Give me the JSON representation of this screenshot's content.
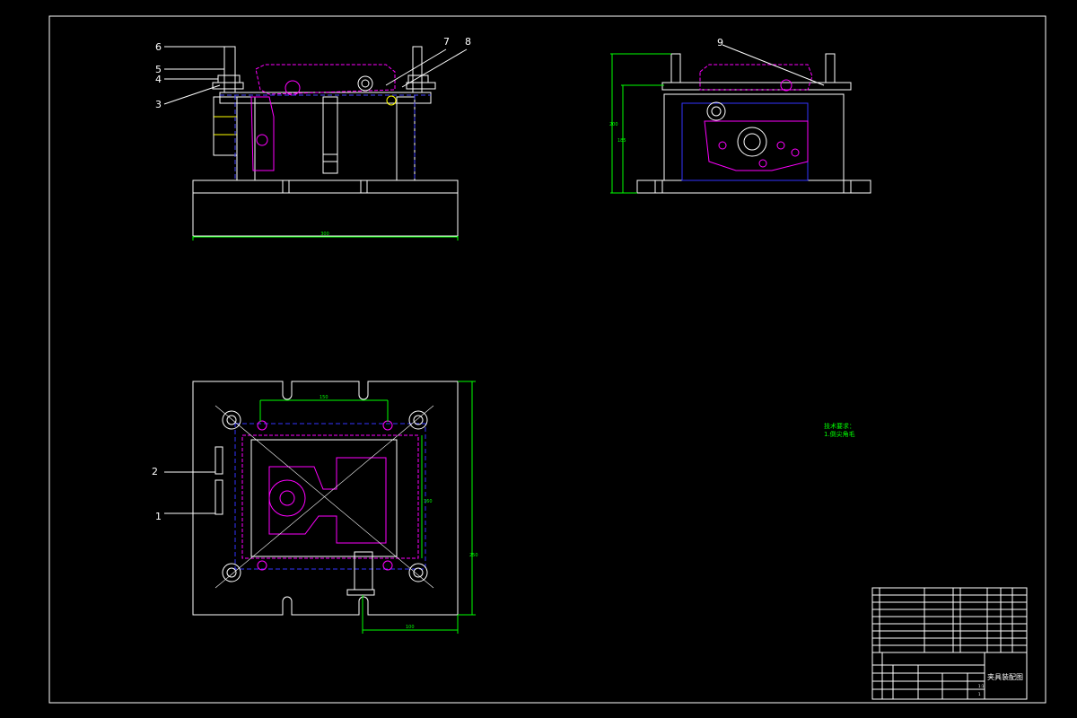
{
  "colors": {
    "background": "#000000",
    "outline": "#ffffff",
    "workpiece": "#ff00ff",
    "hidden_line": "#2020ff",
    "dimension": "#00ff00"
  },
  "part_labels": {
    "front_view": [
      "6",
      "5",
      "4",
      "3",
      "7",
      "8"
    ],
    "side_view": [
      "9"
    ],
    "top_view": [
      "2",
      "1"
    ]
  },
  "dimensions": {
    "front_width": "300",
    "side_height_outer": "200",
    "side_height_inner": "185",
    "top_inner_width": "150",
    "top_inner_height": "160",
    "top_outer_height": "250",
    "top_bottom_offset": "100"
  },
  "technical_requirements": {
    "heading": "技术要求：",
    "item_1": "1.倒尖角毛"
  },
  "title_block": {
    "drawing_title": "夹具装配图",
    "scale": "1:1",
    "sheet": "1"
  }
}
